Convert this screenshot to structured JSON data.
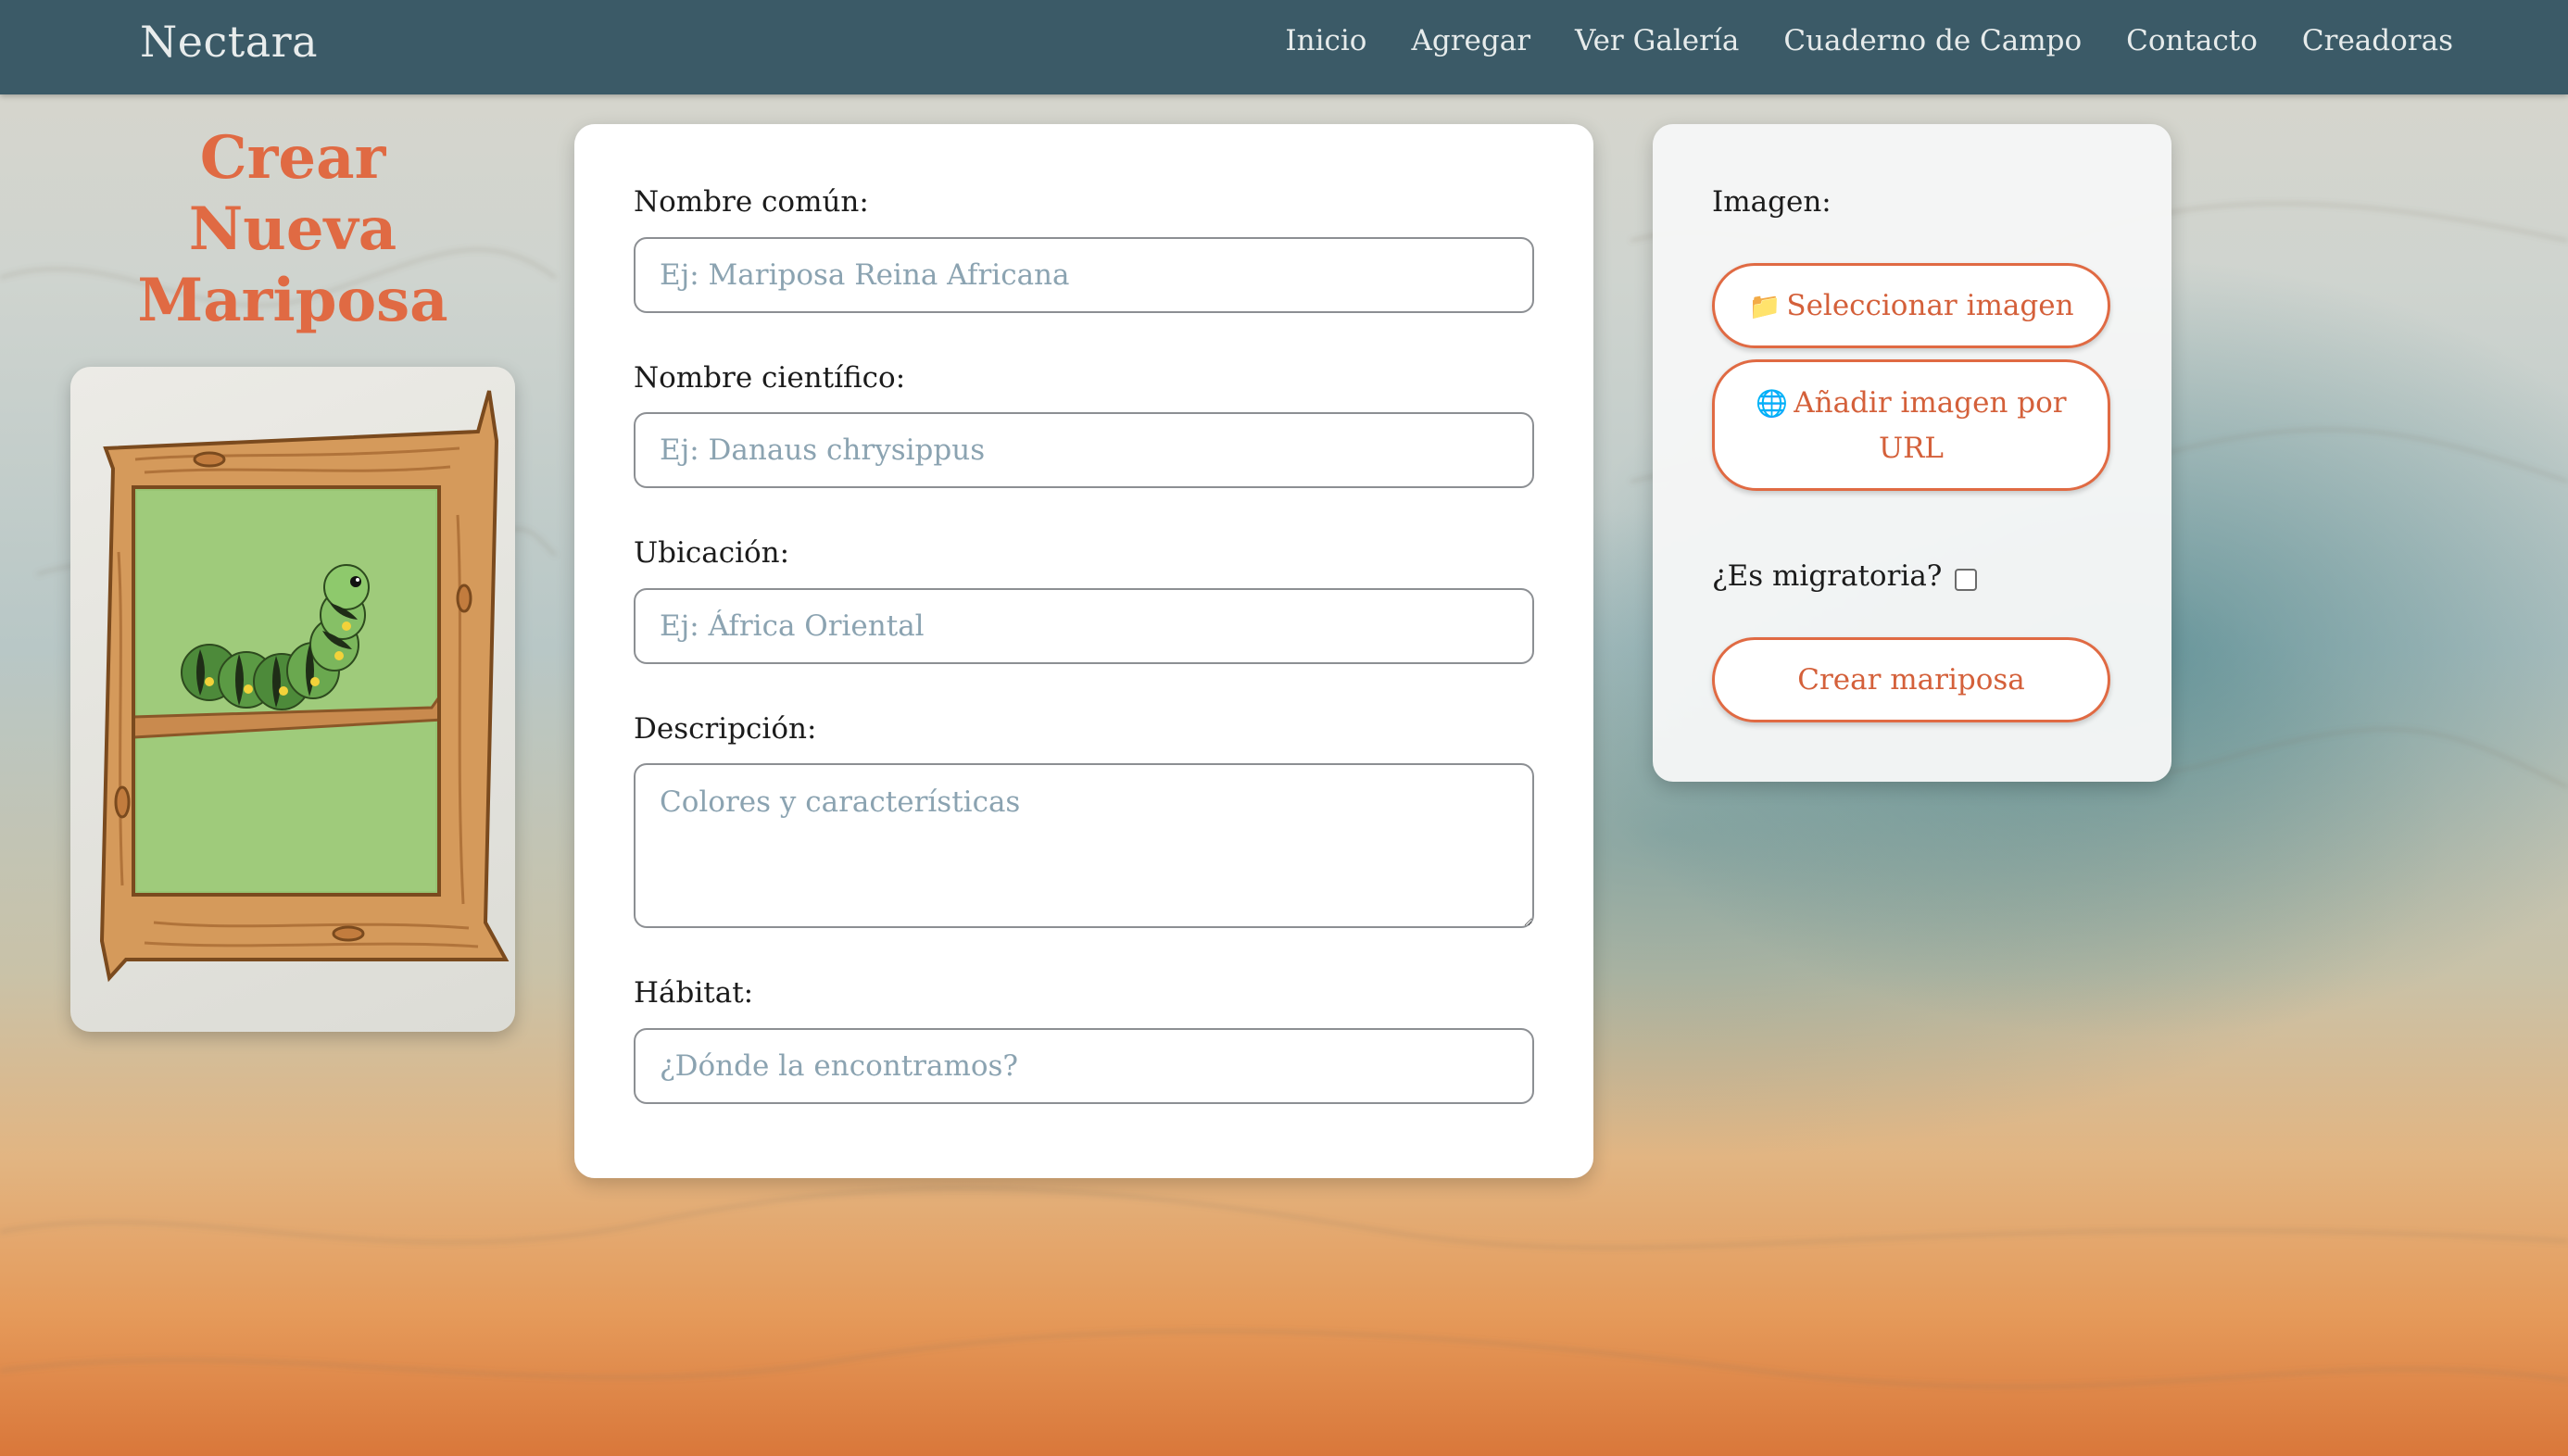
{
  "navbar": {
    "brand": "Nectara",
    "links": [
      "Inicio",
      "Agregar",
      "Ver Galería",
      "Cuaderno de Campo",
      "Contacto",
      "Creadoras"
    ]
  },
  "hero": {
    "title_lines": [
      "Crear",
      "Nueva",
      "Mariposa"
    ]
  },
  "form": {
    "common_name": {
      "label": "Nombre común:",
      "placeholder": "Ej: Mariposa Reina Africana",
      "value": ""
    },
    "scientific_name": {
      "label": "Nombre científico:",
      "placeholder": "Ej: Danaus chrysippus",
      "value": ""
    },
    "location": {
      "label": "Ubicación:",
      "placeholder": "Ej: África Oriental",
      "value": ""
    },
    "description": {
      "label": "Descripción:",
      "placeholder": "Colores y características",
      "value": ""
    },
    "habitat": {
      "label": "Hábitat:",
      "placeholder": "¿Dónde la encontramos?",
      "value": ""
    }
  },
  "side": {
    "image_label": "Imagen:",
    "select_image_icon": "📁",
    "select_image_label": "Seleccionar imagen",
    "url_image_icon": "🌐",
    "url_image_label_line1": "Añadir imagen por",
    "url_image_label_line2": "URL",
    "migratory_label": "¿Es migratoria?",
    "migratory_checked": false,
    "create_label": "Crear mariposa"
  },
  "colors": {
    "navbar": "#3b5a67",
    "accent": "#e06a43",
    "placeholder": "#8ba3b1"
  },
  "icons": {
    "folder": "folder-icon",
    "globe": "globe-icon"
  }
}
